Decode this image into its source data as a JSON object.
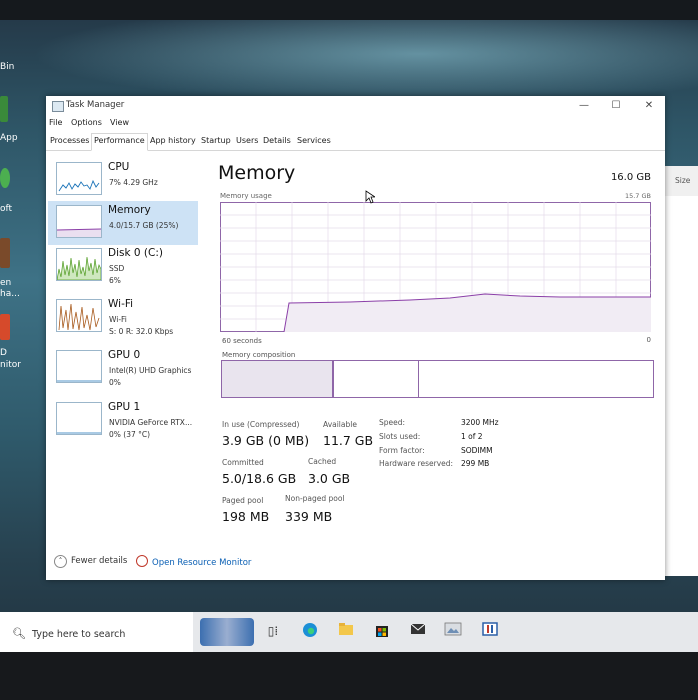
{
  "window": {
    "title": "Task Manager",
    "minimize": "—",
    "maximize": "☐",
    "close": "✕"
  },
  "menu": [
    "File",
    "Options",
    "View"
  ],
  "tabs": [
    "Processes",
    "Performance",
    "App history",
    "Startup",
    "Users",
    "Details",
    "Services"
  ],
  "active_tab": "Performance",
  "resources": [
    {
      "name": "CPU",
      "sub1": "7% 4.29 GHz",
      "sub2": "",
      "sub3": "",
      "color": "#1a73b8"
    },
    {
      "name": "Memory",
      "sub1": "4.0/15.7 GB (25%)",
      "sub2": "",
      "sub3": "",
      "color": "#8b3fa8"
    },
    {
      "name": "Disk 0 (C:)",
      "sub1": "SSD",
      "sub2": "6%",
      "sub3": "",
      "color": "#4d9a1e"
    },
    {
      "name": "Wi-Fi",
      "sub1": "Wi-Fi",
      "sub2": "S: 0 R: 32.0 Kbps",
      "sub3": "",
      "color": "#a85a1d"
    },
    {
      "name": "GPU 0",
      "sub1": "Intel(R) UHD Graphics",
      "sub2": "0%",
      "sub3": "",
      "color": "#1a73b8"
    },
    {
      "name": "GPU 1",
      "sub1": "NVIDIA GeForce RTX...",
      "sub2": "0% (37 °C)",
      "sub3": "",
      "color": "#1a73b8"
    }
  ],
  "memory": {
    "title": "Memory",
    "total": "16.0 GB",
    "usage_label": "Memory usage",
    "usage_max": "15.7 GB",
    "seconds_label": "60 seconds",
    "zero_label": "0",
    "composition_label": "Memory composition",
    "in_use_label": "In use (Compressed)",
    "in_use_value": "3.9 GB (0 MB)",
    "available_label": "Available",
    "available_value": "11.7 GB",
    "committed_label": "Committed",
    "committed_value": "5.0/18.6 GB",
    "cached_label": "Cached",
    "cached_value": "3.0 GB",
    "paged_label": "Paged pool",
    "paged_value": "198 MB",
    "nonpaged_label": "Non-paged pool",
    "nonpaged_value": "339 MB",
    "speed_label": "Speed:",
    "speed_value": "3200 MHz",
    "slots_label": "Slots used:",
    "slots_value": "1 of 2",
    "form_label": "Form factor:",
    "form_value": "SODIMM",
    "hwres_label": "Hardware reserved:",
    "hwres_value": "299 MB",
    "usage_fraction": 0.25,
    "graph_color": "#8b3fa8"
  },
  "footer": {
    "fewer": "Fewer details",
    "open_monitor": "Open Resource Monitor"
  },
  "taskbar": {
    "search_placeholder": "Type here to search",
    "icons": [
      "weather-icon",
      "task-view-icon",
      "edge-icon",
      "file-explorer-icon",
      "store-icon",
      "mail-icon",
      "photos-icon",
      "app-icon"
    ]
  },
  "desktop": {
    "labels": [
      "Bin",
      "App",
      "oft",
      "en",
      "ha...",
      "D",
      "nitor"
    ],
    "right_label": "Size"
  }
}
